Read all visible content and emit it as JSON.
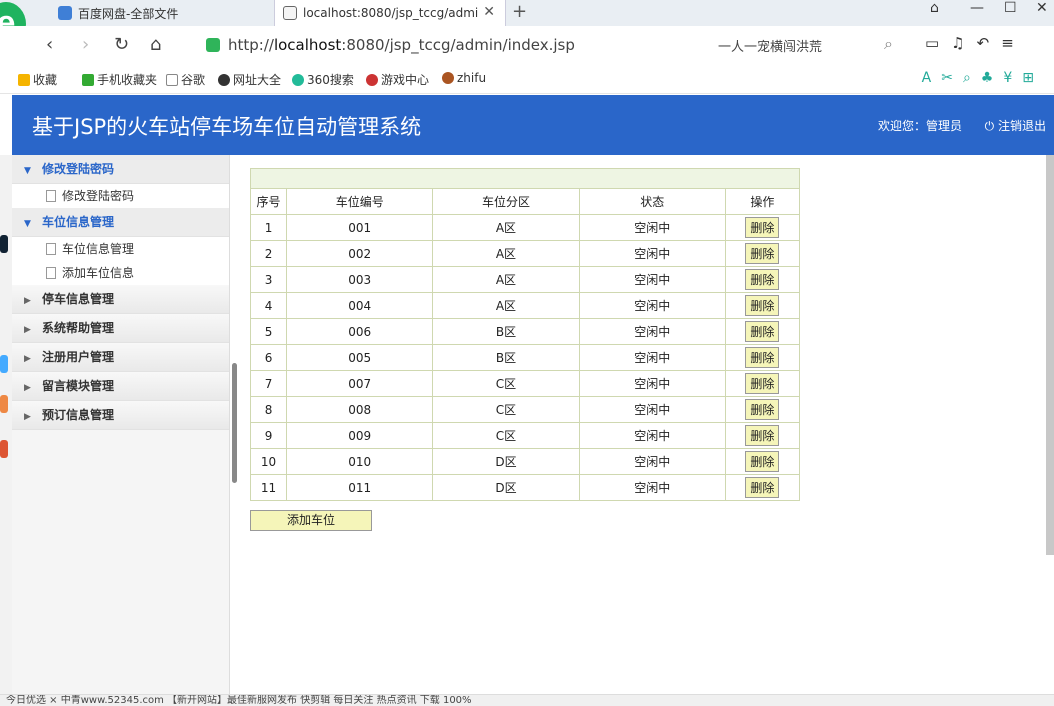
{
  "browser": {
    "tabs": [
      {
        "title": "百度网盘-全部文件"
      },
      {
        "title": "localhost:8080/jsp_tccg/admi"
      }
    ],
    "url_prefix": "http://",
    "url_host": "localhost",
    "url_rest": ":8080/jsp_tccg/admin/index.jsp",
    "search_text": "一人一宠横闯洪荒",
    "bookmarks": [
      "收藏",
      "手机收藏夹",
      "谷歌",
      "网址大全",
      "360搜索",
      "游戏中心",
      "zhifu"
    ],
    "status_text": "今日优选    × 中青www.52345.com 【新开网站】最佳新服网发布    快剪辑   每日关注   热点资讯          下载          100%"
  },
  "app": {
    "title": "基于JSP的火车站停车场车位自动管理系统",
    "welcome": "欢迎您：管理员",
    "logout": "注销退出"
  },
  "sidebar": {
    "groups": [
      {
        "label": "修改登陆密码",
        "items": [
          "修改登陆密码"
        ]
      },
      {
        "label": "车位信息管理",
        "items": [
          "车位信息管理",
          "添加车位信息"
        ]
      },
      {
        "label": "停车信息管理"
      },
      {
        "label": "系统帮助管理"
      },
      {
        "label": "注册用户管理"
      },
      {
        "label": "留言模块管理"
      },
      {
        "label": "预订信息管理"
      }
    ]
  },
  "table": {
    "headers": [
      "序号",
      "车位编号",
      "车位分区",
      "状态",
      "操作"
    ],
    "delete_label": "删除",
    "rows": [
      [
        "1",
        "001",
        "A区",
        "空闲中"
      ],
      [
        "2",
        "002",
        "A区",
        "空闲中"
      ],
      [
        "3",
        "003",
        "A区",
        "空闲中"
      ],
      [
        "4",
        "004",
        "A区",
        "空闲中"
      ],
      [
        "5",
        "006",
        "B区",
        "空闲中"
      ],
      [
        "6",
        "005",
        "B区",
        "空闲中"
      ],
      [
        "7",
        "007",
        "C区",
        "空闲中"
      ],
      [
        "8",
        "008",
        "C区",
        "空闲中"
      ],
      [
        "9",
        "009",
        "C区",
        "空闲中"
      ],
      [
        "10",
        "010",
        "D区",
        "空闲中"
      ],
      [
        "11",
        "011",
        "D区",
        "空闲中"
      ]
    ],
    "add_label": "添加车位"
  },
  "colors": {
    "header_bg": "#2a66c9",
    "table_border": "#cfd8b0",
    "button_bg": "#f5f5b9"
  }
}
